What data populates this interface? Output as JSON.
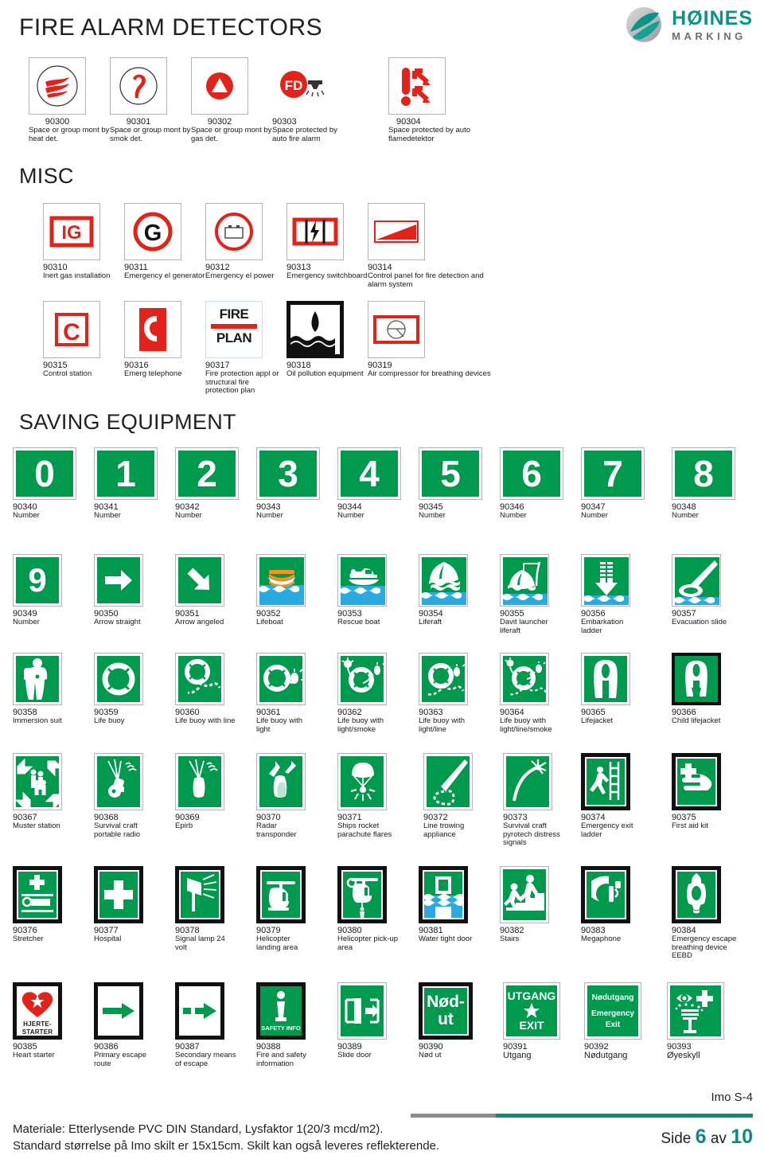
{
  "header": {
    "title": "FIRE ALARM DETECTORS",
    "logo": {
      "name": "HØINES",
      "sub": "MARKING",
      "mark": "globe-swoosh-logo",
      "color": "#0b9486"
    }
  },
  "sections": [
    {
      "id": "fire-alarm-detectors",
      "title": "FIRE ALARM DETECTORS"
    },
    {
      "id": "misc",
      "title": "MISC"
    },
    {
      "id": "saving-equipment",
      "title": "SAVING EQUIPMENT"
    }
  ],
  "rows": {
    "detectors": [
      {
        "code": "90300",
        "desc": "Space or group mont by heat det.",
        "icon": "heat-detector-icon"
      },
      {
        "code": "90301",
        "desc": "Space or group mont by smok det.",
        "icon": "smoke-detector-icon"
      },
      {
        "code": "90302",
        "desc": "Space or group mont by gas det.",
        "icon": "gas-detector-icon"
      },
      {
        "code": "90303",
        "desc": "Space protected by auto fire alarm",
        "icon": "fd-sprinkler-icon"
      },
      {
        "code": "90304",
        "desc": "Space protected by auto flamedetektor",
        "icon": "flame-detector-icon"
      }
    ],
    "misc1": [
      {
        "code": "90310",
        "desc": "Inert gas installation",
        "icon": "ig-box-icon"
      },
      {
        "code": "90311",
        "desc": "Emergency el generator",
        "icon": "g-circle-icon"
      },
      {
        "code": "90312",
        "desc": "Emergency el power",
        "icon": "battery-circle-icon"
      },
      {
        "code": "90313",
        "desc": "Emergency switchboard",
        "icon": "switchboard-icon"
      },
      {
        "code": "90314",
        "desc": "Control panel for fire detection and alarm system",
        "icon": "control-panel-icon"
      }
    ],
    "misc2": [
      {
        "code": "90315",
        "desc": "Control station",
        "icon": "c-box-icon"
      },
      {
        "code": "90316",
        "desc": "Emerg telephone",
        "icon": "telephone-icon"
      },
      {
        "code": "90317",
        "desc": "Fire protection appl or structural fire protection plan",
        "icon": "fire-plan-icon",
        "text1": "FIRE",
        "text2": "PLAN"
      },
      {
        "code": "90318",
        "desc": "Oil pollution equipment",
        "icon": "oil-pollution-icon"
      },
      {
        "code": "90319",
        "desc": "Air compressor for breathing devices",
        "icon": "air-compressor-icon"
      }
    ],
    "numbers1": [
      {
        "code": "90340",
        "desc": "Number",
        "icon": "number-0-icon",
        "glyph": "0"
      },
      {
        "code": "90341",
        "desc": "Number",
        "icon": "number-1-icon",
        "glyph": "1"
      },
      {
        "code": "90342",
        "desc": "Number",
        "icon": "number-2-icon",
        "glyph": "2"
      },
      {
        "code": "90343",
        "desc": "Number",
        "icon": "number-3-icon",
        "glyph": "3"
      },
      {
        "code": "90344",
        "desc": "Number",
        "icon": "number-4-icon",
        "glyph": "4"
      },
      {
        "code": "90345",
        "desc": "Number",
        "icon": "number-5-icon",
        "glyph": "5"
      },
      {
        "code": "90346",
        "desc": "Number",
        "icon": "number-6-icon",
        "glyph": "6"
      },
      {
        "code": "90347",
        "desc": "Number",
        "icon": "number-7-icon",
        "glyph": "7"
      },
      {
        "code": "90348",
        "desc": "Number",
        "icon": "number-8-icon",
        "glyph": "8"
      }
    ],
    "row349": [
      {
        "code": "90349",
        "desc": "Number",
        "icon": "number-9-icon",
        "glyph": "9"
      },
      {
        "code": "90350",
        "desc": "Arrow straight",
        "icon": "arrow-straight-icon"
      },
      {
        "code": "90351",
        "desc": "Arrow angeled",
        "icon": "arrow-angled-icon"
      },
      {
        "code": "90352",
        "desc": "Lifeboat",
        "icon": "lifeboat-icon"
      },
      {
        "code": "90353",
        "desc": "Rescue boat",
        "icon": "rescue-boat-icon"
      },
      {
        "code": "90354",
        "desc": "Liferaft",
        "icon": "liferaft-icon"
      },
      {
        "code": "90355",
        "desc": "Davit launcher liferaft",
        "icon": "davit-launcher-liferaft-icon"
      },
      {
        "code": "90356",
        "desc": "Embarkation ladder",
        "icon": "embarkation-ladder-icon"
      },
      {
        "code": "90357",
        "desc": "Evacuation slide",
        "icon": "evacuation-slide-icon"
      }
    ],
    "row358": [
      {
        "code": "90358",
        "desc": "Immersion suit",
        "icon": "immersion-suit-icon"
      },
      {
        "code": "90359",
        "desc": "Life buoy",
        "icon": "life-buoy-icon"
      },
      {
        "code": "90360",
        "desc": "Life buoy with line",
        "icon": "life-buoy-line-icon"
      },
      {
        "code": "90361",
        "desc": "Life buoy with light",
        "icon": "life-buoy-light-icon"
      },
      {
        "code": "90362",
        "desc": "Life buoy with light/smoke",
        "icon": "life-buoy-light-smoke-icon"
      },
      {
        "code": "90363",
        "desc": "Life buoy with light/line",
        "icon": "life-buoy-light-line-icon"
      },
      {
        "code": "90364",
        "desc": "Life buoy with light/line/smoke",
        "icon": "life-buoy-light-line-smoke-icon"
      },
      {
        "code": "90365",
        "desc": "Lifejacket",
        "icon": "lifejacket-icon"
      },
      {
        "code": "90366",
        "desc": "Child lifejacket",
        "icon": "child-lifejacket-icon"
      }
    ],
    "row367": [
      {
        "code": "90367",
        "desc": "Muster station",
        "icon": "muster-station-icon"
      },
      {
        "code": "90368",
        "desc": "Survival craft portable radio",
        "icon": "portable-radio-icon"
      },
      {
        "code": "90369",
        "desc": "Epirb",
        "icon": "epirb-icon"
      },
      {
        "code": "90370",
        "desc": "Radar transponder",
        "icon": "radar-transponder-icon"
      },
      {
        "code": "90371",
        "desc": "Ships rocket parachute flares",
        "icon": "parachute-flare-icon"
      },
      {
        "code": "90372",
        "desc": "Line trowing appliance",
        "icon": "line-throwing-appliance-icon"
      },
      {
        "code": "90373",
        "desc": "Survival craft pyrotech distress signals",
        "icon": "pyrotechnic-distress-signal-icon"
      },
      {
        "code": "90374",
        "desc": "Emergency exit ladder",
        "icon": "emergency-exit-ladder-icon"
      },
      {
        "code": "90375",
        "desc": "First aid kit",
        "icon": "first-aid-kit-icon"
      }
    ],
    "row376": [
      {
        "code": "90376",
        "desc": "Stretcher",
        "icon": "stretcher-icon"
      },
      {
        "code": "90377",
        "desc": "Hospital",
        "icon": "hospital-icon"
      },
      {
        "code": "90378",
        "desc": "Signal lamp 24 volt",
        "icon": "signal-lamp-icon"
      },
      {
        "code": "90379",
        "desc": "Helicopter landing area",
        "icon": "helicopter-landing-icon"
      },
      {
        "code": "90380",
        "desc": "Helicopter pick-up area",
        "icon": "helicopter-pickup-icon"
      },
      {
        "code": "90381",
        "desc": "Water tight door",
        "icon": "watertight-door-icon"
      },
      {
        "code": "90382",
        "desc": "Stairs",
        "icon": "stairs-icon"
      },
      {
        "code": "90383",
        "desc": "Megaphone",
        "icon": "megaphone-icon"
      },
      {
        "code": "90384",
        "desc": "Emergency escape breathing device EEBD",
        "icon": "eebd-icon"
      }
    ],
    "row385": [
      {
        "code": "90385",
        "desc": "Heart starter",
        "icon": "heart-starter-icon",
        "text1": "HJERTE-",
        "text2": "STARTER"
      },
      {
        "code": "90386",
        "desc": "Primary escape route",
        "icon": "primary-escape-route-icon"
      },
      {
        "code": "90387",
        "desc": "Secondary means of escape",
        "icon": "secondary-escape-icon"
      },
      {
        "code": "90388",
        "desc": "Fire and safety information",
        "icon": "safety-info-icon",
        "text1": "SAFETY INFO"
      },
      {
        "code": "90389",
        "desc": "Slide door",
        "icon": "slide-door-icon"
      },
      {
        "code": "90390",
        "desc": "Nød ut",
        "icon": "nod-ut-icon",
        "text1": "Nød-",
        "text2": "ut"
      },
      {
        "code": "90391",
        "desc": "Utgang",
        "icon": "utgang-exit-icon",
        "text1": "UTGANG",
        "text2": "EXIT"
      },
      {
        "code": "90392",
        "desc": "Nødutgang",
        "icon": "nodutgang-emergency-exit-icon",
        "text1": "Nødutgang",
        "text2": "Emergency",
        "text3": "Exit"
      },
      {
        "code": "90393",
        "desc": "Øyeskyll",
        "icon": "eyewash-icon"
      }
    ]
  },
  "footer": {
    "imo": "Imo S-4",
    "material_line1": "Materiale: Etterlysende  PVC DIN Standard, Lysfaktor 1(20/3 mcd/m2).",
    "material_line2": "Standard størrelse på Imo skilt er 15x15cm. Skilt kan også leveres reflekterende.",
    "page_prefix": "Side",
    "page_number": "6",
    "page_mid": "av",
    "page_total": "10"
  },
  "colors": {
    "safety_green": "#00994d",
    "safety_red": "#e2231a",
    "water_blue": "#29abe2",
    "brand_teal": "#0b9486"
  }
}
